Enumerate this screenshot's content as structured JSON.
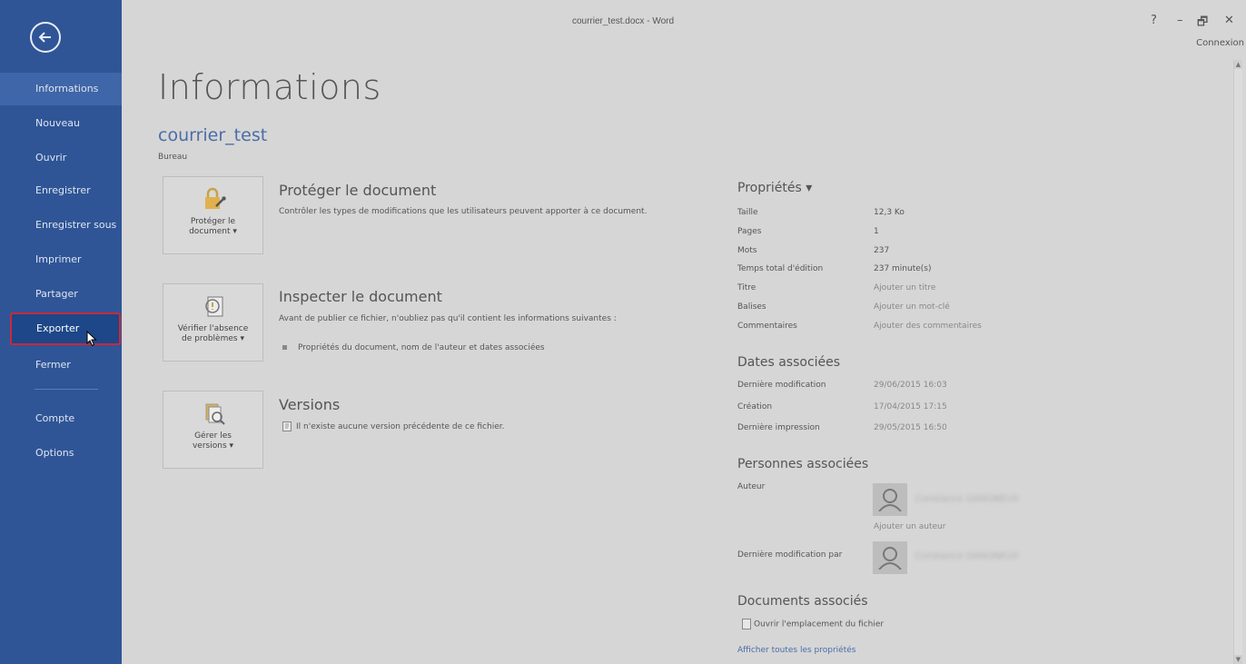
{
  "window": {
    "title": "courrier_test.docx - Word",
    "help": "?",
    "minimize": "–",
    "restore": "🗗",
    "close": "✕",
    "signin": "Connexion"
  },
  "sidebar": {
    "items": [
      {
        "label": "Informations"
      },
      {
        "label": "Nouveau"
      },
      {
        "label": "Ouvrir"
      },
      {
        "label": "Enregistrer"
      },
      {
        "label": "Enregistrer sous"
      },
      {
        "label": "Imprimer"
      },
      {
        "label": "Partager"
      },
      {
        "label": "Exporter"
      },
      {
        "label": "Fermer"
      },
      {
        "label": "Compte"
      },
      {
        "label": "Options"
      }
    ]
  },
  "main": {
    "title": "Informations",
    "doc_name": "courrier_test",
    "doc_location": "Bureau",
    "sections": [
      {
        "button_label": "Protéger le\ndocument ▾",
        "title": "Protéger le document",
        "desc": "Contrôler les types de modifications que les utilisateurs peuvent apporter à ce document."
      },
      {
        "button_label": "Vérifier l'absence\nde problèmes ▾",
        "title": "Inspecter le document",
        "desc": "Avant de publier ce fichier, n'oubliez pas qu'il contient les informations suivantes :",
        "bullet": "Propriétés du document, nom de l'auteur et dates associées"
      },
      {
        "button_label": "Gérer les\nversions ▾",
        "title": "Versions",
        "desc": "Il n'existe aucune version précédente de ce fichier."
      }
    ]
  },
  "properties": {
    "heading": "Propriétés ▾",
    "rows": [
      {
        "key": "Taille",
        "value": "12,3 Ko"
      },
      {
        "key": "Pages",
        "value": "1"
      },
      {
        "key": "Mots",
        "value": "237"
      },
      {
        "key": "Temps total d'édition",
        "value": "237 minute(s)"
      },
      {
        "key": "Titre",
        "value": "Ajouter un titre"
      },
      {
        "key": "Balises",
        "value": "Ajouter un mot-clé"
      },
      {
        "key": "Commentaires",
        "value": "Ajouter des commentaires"
      }
    ],
    "dates_heading": "Dates associées",
    "dates": [
      {
        "key": "Dernière modification",
        "value": "29/06/2015 16:03"
      },
      {
        "key": "Création",
        "value": "17/04/2015 17:15"
      },
      {
        "key": "Dernière impression",
        "value": "29/05/2015 16:50"
      }
    ],
    "people_heading": "Personnes associées",
    "author_label": "Auteur",
    "author_name": "Constance GANONEUX",
    "add_author": "Ajouter un auteur",
    "last_modified_by_label": "Dernière modification par",
    "last_modified_by_name": "Constance GANONEUX",
    "docs_heading": "Documents associés",
    "open_location": "Ouvrir l'emplacement du fichier",
    "show_all": "Afficher toutes les propriétés"
  },
  "colors": {
    "sidebar": "#2f5597",
    "sidebar_active": "#3f66a8",
    "highlight_border": "#c9293a",
    "link": "#4a6da7",
    "background": "#d6d6d6"
  }
}
